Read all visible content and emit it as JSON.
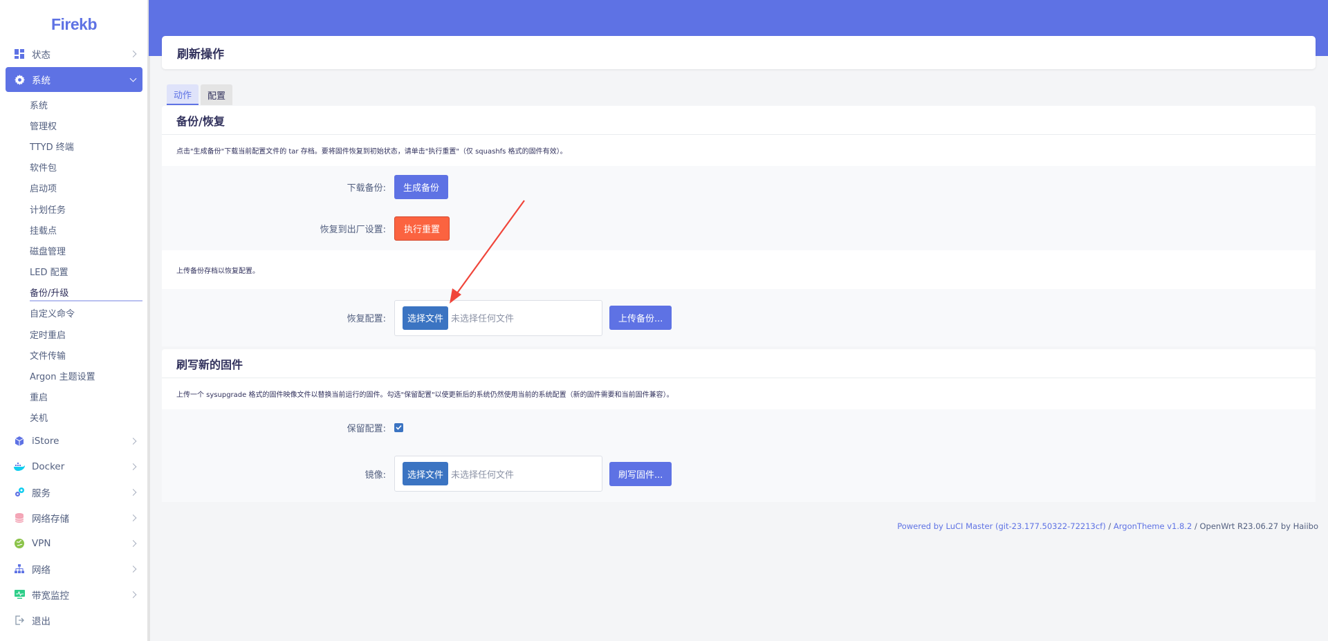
{
  "brand": "Firekb",
  "sidebar": {
    "items": [
      {
        "label": "状态",
        "icon": "dashboard-icon"
      },
      {
        "label": "系统",
        "icon": "gear-icon"
      },
      {
        "label": "iStore",
        "icon": "box-icon"
      },
      {
        "label": "Docker",
        "icon": "docker-icon"
      },
      {
        "label": "服务",
        "icon": "services-icon"
      },
      {
        "label": "网络存储",
        "icon": "database-icon"
      },
      {
        "label": "VPN",
        "icon": "vpn-icon"
      },
      {
        "label": "网络",
        "icon": "network-icon"
      },
      {
        "label": "带宽监控",
        "icon": "monitor-icon"
      },
      {
        "label": "退出",
        "icon": "logout-icon"
      }
    ],
    "submenu": [
      "系统",
      "管理权",
      "TTYD 终端",
      "软件包",
      "启动项",
      "计划任务",
      "挂载点",
      "磁盘管理",
      "LED 配置",
      "备份/升级",
      "自定义命令",
      "定时重启",
      "文件传输",
      "Argon 主题设置",
      "重启",
      "关机"
    ]
  },
  "page": {
    "title": "刷新操作",
    "tabs": [
      "动作",
      "配置"
    ]
  },
  "backup": {
    "title": "备份/恢复",
    "desc": "点击\"生成备份\"下载当前配置文件的 tar 存档。要将固件恢复到初始状态，请单击\"执行重置\"（仅 squashfs 格式的固件有效）。",
    "download_label": "下载备份:",
    "generate_btn": "生成备份",
    "reset_label": "恢复到出厂设置:",
    "reset_btn": "执行重置",
    "upload_desc": "上传备份存档以恢复配置。",
    "restore_label": "恢复配置:",
    "choose_file": "选择文件",
    "no_file": "未选择任何文件",
    "upload_btn": "上传备份..."
  },
  "flash": {
    "title": "刷写新的固件",
    "desc": "上传一个 sysupgrade 格式的固件映像文件以替换当前运行的固件。勾选\"保留配置\"以使更新后的系统仍然使用当前的系统配置（新的固件需要和当前固件兼容）。",
    "keep_label": "保留配置:",
    "keep_checked": true,
    "image_label": "镜像:",
    "choose_file": "选择文件",
    "no_file": "未选择任何文件",
    "flash_btn": "刷写固件..."
  },
  "footer": {
    "luci": "Powered by LuCI Master (git-23.177.50322-72213cf)",
    "sep1": " / ",
    "theme": "ArgonTheme v1.8.2",
    "rest": " / OpenWrt R23.06.27 by Haiibo"
  },
  "colors": {
    "accent": "#5e72e4",
    "danger": "#fb6340",
    "file_btn": "#3b74c2"
  }
}
